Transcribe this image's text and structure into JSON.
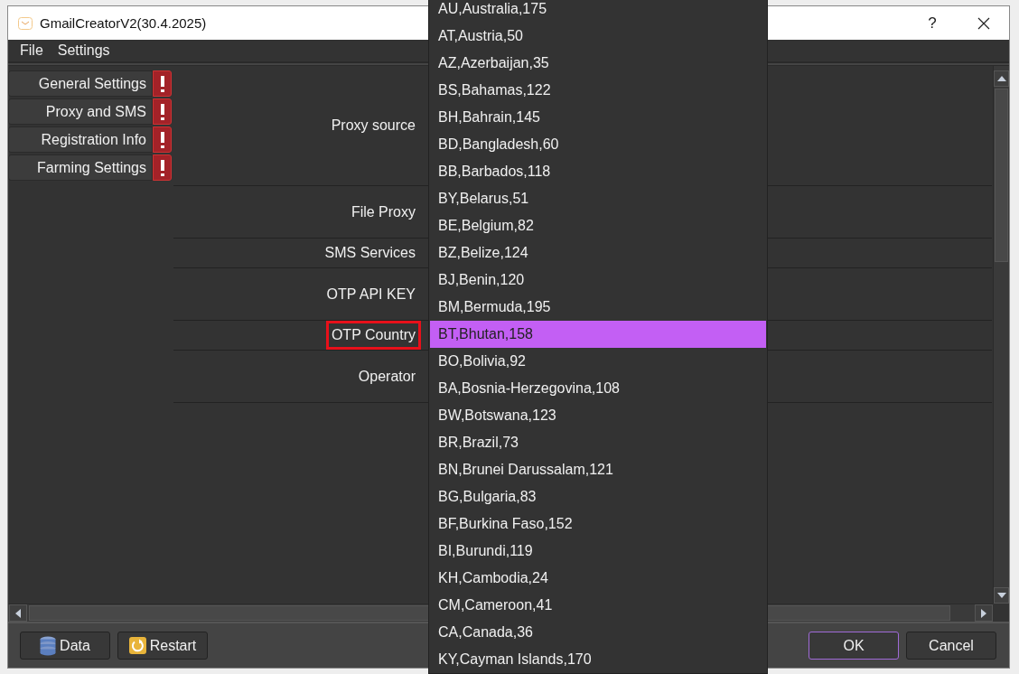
{
  "window": {
    "title": "GmailCreatorV2(30.4.2025)",
    "help_button": "?"
  },
  "menu": [
    "File",
    "Settings"
  ],
  "sidebar": {
    "items": [
      {
        "label": "General Settings",
        "warning": true
      },
      {
        "label": "Proxy and SMS",
        "warning": true
      },
      {
        "label": "Registration Info",
        "warning": true
      },
      {
        "label": "Farming Settings",
        "warning": true
      }
    ]
  },
  "form": {
    "rows": [
      {
        "label": "Proxy source",
        "highlighted": false
      },
      {
        "label": "File Proxy",
        "highlighted": false
      },
      {
        "label": "SMS Services",
        "highlighted": false
      },
      {
        "label": "OTP API KEY",
        "highlighted": false
      },
      {
        "label": "OTP Country",
        "highlighted": true
      },
      {
        "label": "Operator",
        "highlighted": false
      }
    ]
  },
  "dropdown": {
    "items": [
      {
        "label": "AU,Australia,175",
        "selected": false
      },
      {
        "label": "AT,Austria,50",
        "selected": false
      },
      {
        "label": "AZ,Azerbaijan,35",
        "selected": false
      },
      {
        "label": "BS,Bahamas,122",
        "selected": false
      },
      {
        "label": "BH,Bahrain,145",
        "selected": false
      },
      {
        "label": "BD,Bangladesh,60",
        "selected": false
      },
      {
        "label": "BB,Barbados,118",
        "selected": false
      },
      {
        "label": "BY,Belarus,51",
        "selected": false
      },
      {
        "label": "BE,Belgium,82",
        "selected": false
      },
      {
        "label": "BZ,Belize,124",
        "selected": false
      },
      {
        "label": "BJ,Benin,120",
        "selected": false
      },
      {
        "label": "BM,Bermuda,195",
        "selected": false
      },
      {
        "label": "BT,Bhutan,158",
        "selected": true
      },
      {
        "label": "BO,Bolivia,92",
        "selected": false
      },
      {
        "label": "BA,Bosnia-Herzegovina,108",
        "selected": false
      },
      {
        "label": "BW,Botswana,123",
        "selected": false
      },
      {
        "label": "BR,Brazil,73",
        "selected": false
      },
      {
        "label": "BN,Brunei Darussalam,121",
        "selected": false
      },
      {
        "label": "BG,Bulgaria,83",
        "selected": false
      },
      {
        "label": "BF,Burkina Faso,152",
        "selected": false
      },
      {
        "label": "BI,Burundi,119",
        "selected": false
      },
      {
        "label": "KH,Cambodia,24",
        "selected": false
      },
      {
        "label": "CM,Cameroon,41",
        "selected": false
      },
      {
        "label": "CA,Canada,36",
        "selected": false
      },
      {
        "label": "KY,Cayman Islands,170",
        "selected": false
      }
    ]
  },
  "footer": {
    "buttons": [
      {
        "label": "Data",
        "kind": "data",
        "default": false
      },
      {
        "label": "Restart",
        "kind": "restart",
        "default": false
      },
      {
        "label": "OK",
        "kind": "plain",
        "default": true
      },
      {
        "label": "Cancel",
        "kind": "plain",
        "default": false
      }
    ]
  }
}
